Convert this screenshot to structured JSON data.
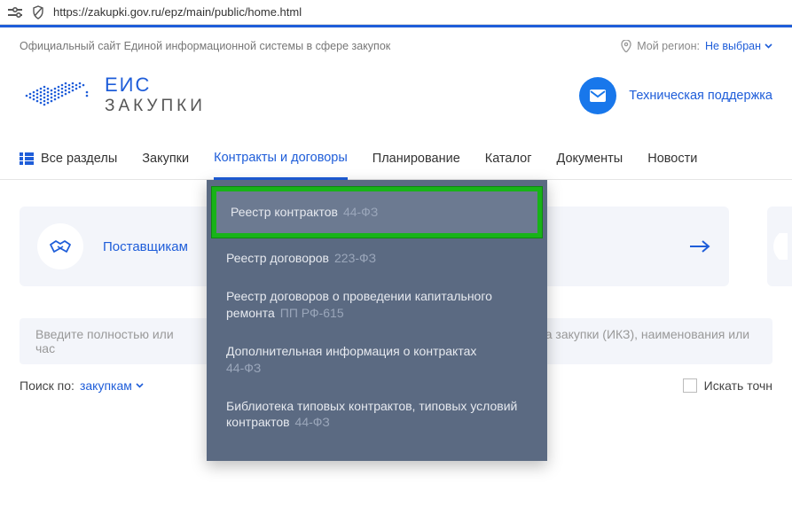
{
  "url": "https://zakupki.gov.ru/epz/main/public/home.html",
  "info_bar": {
    "description": "Официальный сайт Единой информационной системы в сфере закупок",
    "region_label": "Мой регион:",
    "region_value": "Не выбран"
  },
  "logo": {
    "line1": "ЕИС",
    "line2": "ЗАКУПКИ"
  },
  "support": "Техническая поддержка",
  "nav": {
    "all": "Все разделы",
    "items": [
      "Закупки",
      "Контракты и договоры",
      "Планирование",
      "Каталог",
      "Документы",
      "Новости"
    ]
  },
  "dropdown": [
    {
      "label": "Реестр контрактов",
      "tag": "44-ФЗ"
    },
    {
      "label": "Реестр договоров",
      "tag": "223-ФЗ"
    },
    {
      "label": "Реестр договоров о проведении капитального ремонта",
      "tag": "ПП РФ-615"
    },
    {
      "label": "Дополнительная информация о контрактах",
      "tag": "44-ФЗ"
    },
    {
      "label": "Библиотека типовых контрактов, типовых условий контрактов",
      "tag": "44-ФЗ"
    }
  ],
  "card": {
    "title": "Поставщикам"
  },
  "search": {
    "placeholder_left": "Введите полностью или час",
    "placeholder_right": "кода закупки (ИКЗ), наименования или И",
    "by_label": "Поиск по:",
    "by_value": "закупкам",
    "exact": "Искать точн"
  }
}
